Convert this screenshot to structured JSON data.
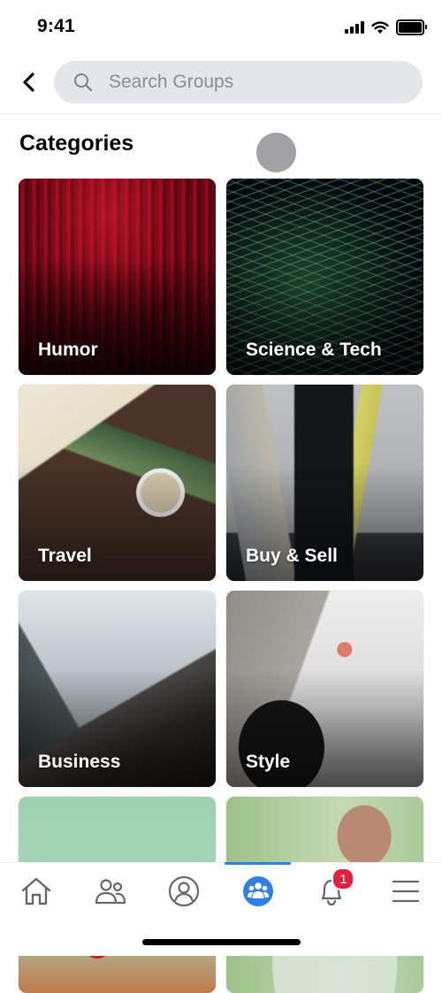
{
  "status_bar": {
    "time": "9:41",
    "icons": [
      "cellular-signal-icon",
      "wifi-icon",
      "battery-icon"
    ]
  },
  "header": {
    "back_icon": "chevron-left-icon",
    "search": {
      "icon": "search-icon",
      "placeholder": "Search Groups",
      "value": ""
    }
  },
  "categories": {
    "title": "Categories",
    "items": [
      {
        "label": "Humor",
        "image": "red theater curtain"
      },
      {
        "label": "Science & Tech",
        "image": "abstract green and blue wave lines"
      },
      {
        "label": "Travel",
        "image": "map, camera, photos and coffee on table"
      },
      {
        "label": "Buy & Sell",
        "image": "person holding shopping bags"
      },
      {
        "label": "Business",
        "image": "skyscrapers viewed from below"
      },
      {
        "label": "Style",
        "image": "flat lay of clothes, clutch and makeup"
      },
      {
        "label": "",
        "image": "person holding tomatoes and carrots"
      },
      {
        "label": "",
        "image": "fish bowl with hand"
      }
    ]
  },
  "tab_bar": {
    "active_index": 3,
    "accent_color": "#2e80e6",
    "badge_color": "#e41e3f",
    "tabs": [
      {
        "name": "home",
        "icon": "home-icon"
      },
      {
        "name": "friends",
        "icon": "friends-icon"
      },
      {
        "name": "profile",
        "icon": "profile-icon"
      },
      {
        "name": "groups",
        "icon": "groups-icon"
      },
      {
        "name": "notifications",
        "icon": "bell-icon",
        "badge": "1"
      },
      {
        "name": "menu",
        "icon": "menu-icon"
      }
    ]
  }
}
